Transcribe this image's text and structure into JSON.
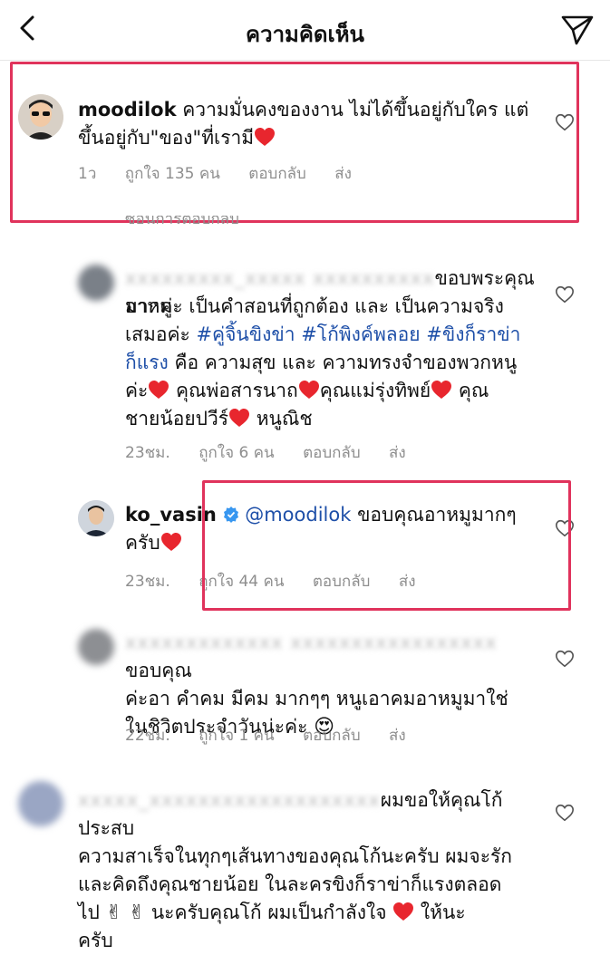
{
  "header": {
    "title": "ความคิดเห็น"
  },
  "comments": [
    {
      "username": "moodilok",
      "text": "ความมั่นคงของงาน ไม่ได้ขึ้นอยู่กับใคร แต่ขึ้นอยู่กับ\"ของ\"ที่เรามี",
      "time": "1ว",
      "likes": "ถูกใจ 135 คน",
      "reply": "ตอบกลับ",
      "send": "ส่ง"
    },
    {
      "line1": "ขอบพระคุณอาหมู",
      "line2": "มากค่ะ เป็นคำสอนที่ถูกต้อง และ เป็นความจริง",
      "line3a": "เสมอค่ะ ",
      "tag1": "#คู่จิ้นขิงข่า",
      "tag2": "#โก้พิงค์พลอย",
      "tag3a": "#ขิงก็ราข่า",
      "tag3b": "ก็แรง",
      "line4": " คือ ความสุข และ ความทรงจำของพวกหนู",
      "line5a": "ค่ะ",
      "line5b": " คุณพ่อสารนาถ",
      "line5c": "คุณแม่รุ่งทิพย์",
      "line5d": " คุณ",
      "line6a": "ชายน้อยปวีร์",
      "line6b": " หนูณิช",
      "time": "23ชม.",
      "likes": "ถูกใจ 6 คน",
      "reply": "ตอบกลับ",
      "send": "ส่ง"
    },
    {
      "username": "ko_vasin",
      "mention": "@moodilok",
      "text": " ขอบคุณอาหมูมากๆ",
      "line2": "ครับ",
      "time": "23ชม.",
      "likes": "ถูกใจ 44 คน",
      "reply": "ตอบกลับ",
      "send": "ส่ง"
    },
    {
      "line1": "ขอบคุณ",
      "line2": "ค่ะอา คำคม มีคม มากๆๆ หนูเอาคมอาหมูมาใช่",
      "line3": "ในชิวิตประจำวันน่ะค่ะ",
      "time": "22ชม.",
      "likes": "ถูกใจ 1 คน",
      "reply": "ตอบกลับ",
      "send": "ส่ง"
    },
    {
      "line1": "ผมขอให้คุณโก้ ประสบ",
      "line2": "ความสาเร็จในทุกๆเส้นทางของคุณโก้นะครับ ผมจะรัก",
      "line3": "และคิดถึงคุณชายน้อย ในละครขิงก็ราข่าก็แรงตลอด",
      "line4a": "ไป",
      "line4b": " นะครับคุณโก้ ผมเป็นกำลังใจ",
      "line4c": " ให้นะ",
      "line5": "ครับ"
    }
  ],
  "partial_text": "ซ่อนการตอบกลับ",
  "colors": {
    "highlight": "#e0335c",
    "link": "#1e4fa8",
    "meta": "#8e8e8e",
    "heart": "#e8262e"
  }
}
